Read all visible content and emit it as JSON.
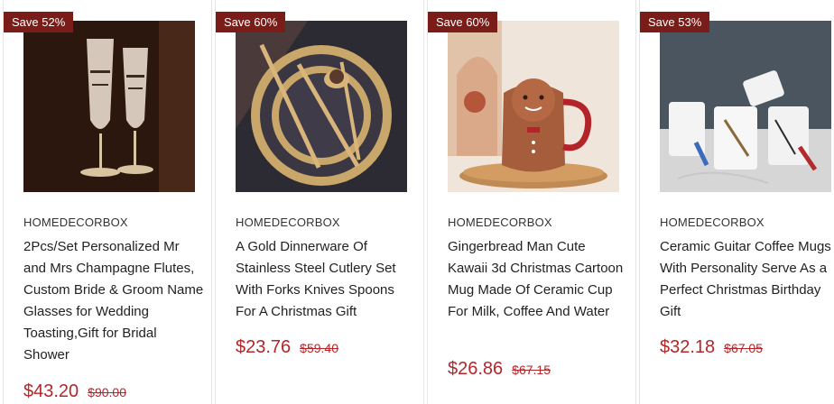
{
  "products": [
    {
      "badge": "Save 52%",
      "brand": "HOMEDECORBOX",
      "title": "2Pcs/Set Personalized Mr and Mrs Champagne Flutes, Custom Bride & Groom Name Glasses for Wedding Toasting,Gift for Bridal Shower",
      "price": "$43.20",
      "old_price": "$90.00",
      "image_icon": "champagne-flutes-image"
    },
    {
      "badge": "Save 60%",
      "brand": "HOMEDECORBOX",
      "title": "A Gold Dinnerware Of Stainless Steel Cutlery Set With Forks Knives Spoons For A Christmas Gift",
      "price": "$23.76",
      "old_price": "$59.40",
      "image_icon": "gold-dinnerware-image"
    },
    {
      "badge": "Save 60%",
      "brand": "HOMEDECORBOX",
      "title": "Gingerbread Man Cute Kawaii 3d Christmas Cartoon Mug Made Of Ceramic Cup For Milk, Coffee And Water",
      "price": "$26.86",
      "old_price": "$67.15",
      "image_icon": "gingerbread-mug-image"
    },
    {
      "badge": "Save 53%",
      "brand": "HOMEDECORBOX",
      "title": "Ceramic Guitar Coffee Mugs With Personality Serve As a Perfect Christmas Birthday Gift",
      "price": "$32.18",
      "old_price": "$67.05",
      "image_icon": "guitar-mugs-image"
    }
  ],
  "colors": {
    "badge_bg": "#7a1c17",
    "price": "#b3262a"
  }
}
